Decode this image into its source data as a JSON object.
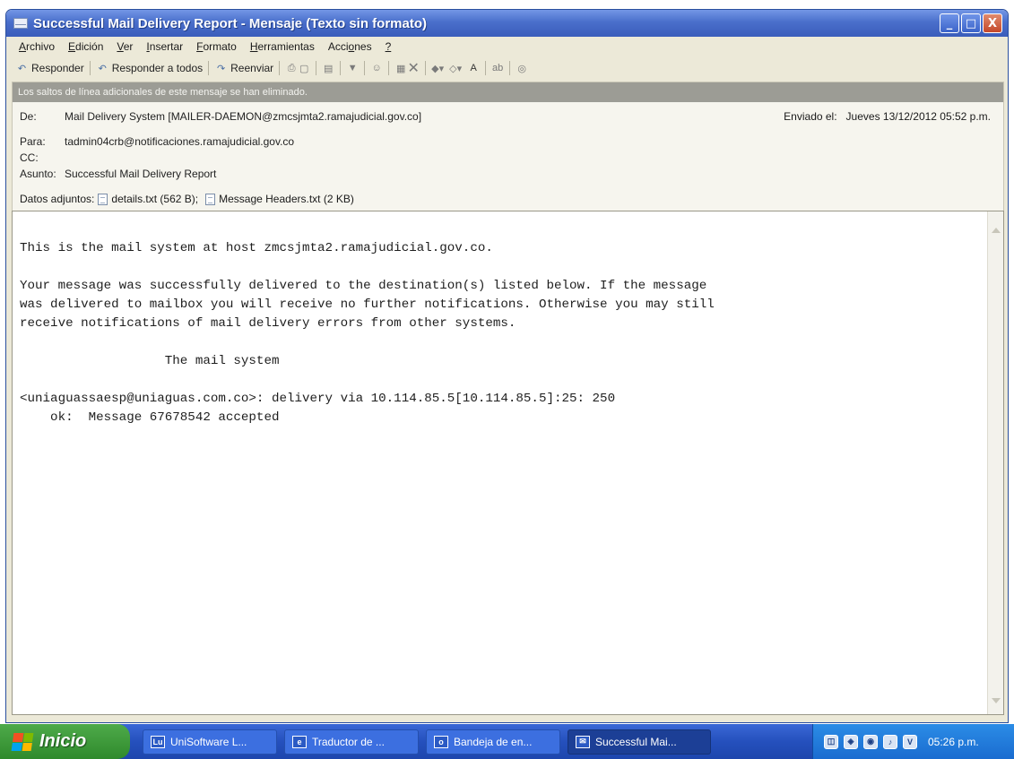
{
  "window": {
    "title": "Successful Mail Delivery Report - Mensaje (Texto sin formato)",
    "buttons": {
      "minimize": "_",
      "maximize": "□",
      "close": "X"
    }
  },
  "menu": [
    "Archivo",
    "Edición",
    "Ver",
    "Insertar",
    "Formato",
    "Herramientas",
    "Acciones",
    "?"
  ],
  "menu_mnemonic_index": [
    0,
    0,
    0,
    0,
    0,
    0,
    4,
    0
  ],
  "toolbar": {
    "reply": "Responder",
    "reply_all": "Responder a todos",
    "forward": "Reenviar"
  },
  "banner": "Los saltos de línea adicionales de este mensaje se han eliminado.",
  "header": {
    "from_label": "De:",
    "from": "Mail Delivery System [MAILER-DAEMON@zmcsjmta2.ramajudicial.gov.co]",
    "sent_label": "Enviado el:",
    "sent": "Jueves 13/12/2012 05:52 p.m.",
    "to_label": "Para:",
    "to": "tadmin04crb@notificaciones.ramajudicial.gov.co",
    "cc_label": "CC:",
    "cc": "",
    "subject_label": "Asunto:",
    "subject": "Successful Mail Delivery Report"
  },
  "attachments": {
    "label": "Datos adjuntos:",
    "file1": "details.txt (562 B);",
    "file2": "Message Headers.txt (2 KB)"
  },
  "body": {
    "line1": "This is the mail system at host zmcsjmta2.ramajudicial.gov.co.",
    "line2": "",
    "line3": "Your message was successfully delivered to the destination(s) listed below. If the message",
    "line4": "was delivered to mailbox you will receive no further notifications. Otherwise you may still",
    "line5": "receive notifications of mail delivery errors from other systems.",
    "line6": "",
    "line7": "                   The mail system",
    "line8": "",
    "line9": "<uniaguassaesp@uniaguas.com.co>: delivery via 10.114.85.5[10.114.85.5]:25: 250",
    "line10": "    ok:  Message 67678542 accepted"
  },
  "taskbar": {
    "start": "Inicio",
    "tasks": [
      "UniSoftware L...",
      "Traductor de ...",
      "Bandeja de en...",
      "Successful Mai..."
    ],
    "clock": "05:26 p.m."
  }
}
